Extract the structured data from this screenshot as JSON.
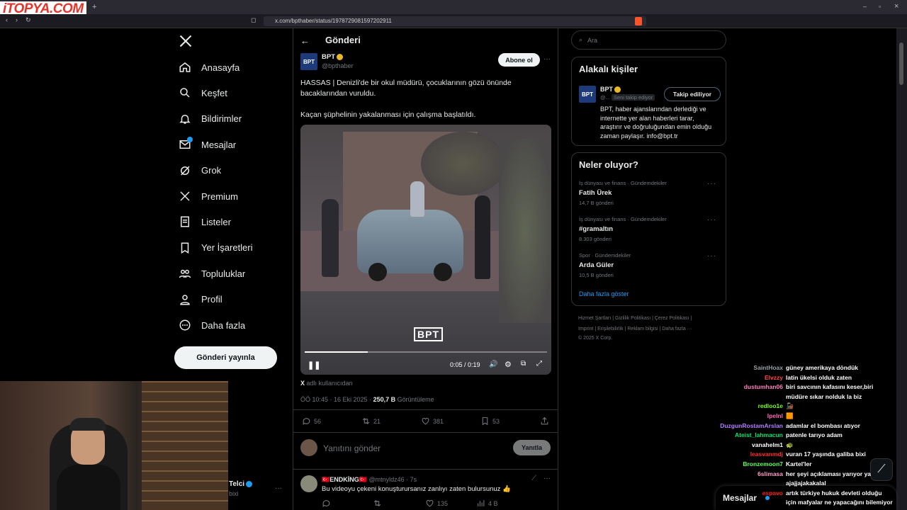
{
  "browser": {
    "watermark": "iTOPYA.COM",
    "new_tab": "+",
    "url": "x.com/bpthaber/status/1978729081597202911",
    "window_controls": [
      "–",
      "▫",
      "×"
    ]
  },
  "nav": {
    "items": [
      {
        "label": "Anasayfa",
        "icon": "home-icon"
      },
      {
        "label": "Keşfet",
        "icon": "search-icon"
      },
      {
        "label": "Bildirimler",
        "icon": "bell-icon"
      },
      {
        "label": "Mesajlar",
        "icon": "mail-icon"
      },
      {
        "label": "Grok",
        "icon": "grok-icon"
      },
      {
        "label": "Premium",
        "icon": "x-logo-icon"
      },
      {
        "label": "Listeler",
        "icon": "list-icon"
      },
      {
        "label": "Yer İşaretleri",
        "icon": "bookmark-icon"
      },
      {
        "label": "Topluluklar",
        "icon": "people-icon"
      },
      {
        "label": "Profil",
        "icon": "person-icon"
      },
      {
        "label": "Daha fazla",
        "icon": "more-circle-icon"
      }
    ],
    "post_button": "Gönderi yayınla",
    "account": {
      "name": "Telci",
      "handle": "bixi"
    }
  },
  "post": {
    "header_title": "Gönderi",
    "author_name": "BPT",
    "author_handle": "@bpthaber",
    "logo_text": "BPT",
    "subscribe_label": "Abone ol",
    "text_line1": "HASSAS | Denizli'de bir okul müdürü, çocuklarının gözü önünde",
    "text_line2": "bacaklarından vuruldu.",
    "text_line3": "Kaçan şüphelinin yakalanması için çalışma başlatıldı.",
    "video_time": "0:05 / 0:19",
    "video_progress": 0.26,
    "video_watermark": "BPT",
    "source_prefix": "X",
    "source_label": "adlı kullanıcıdan",
    "time": "ÖÖ 10:45 · 16 Eki 2025 ·",
    "views": "250,7 B",
    "views_label": "Görüntüleme",
    "replies": "56",
    "reposts": "21",
    "likes": "381",
    "bookmarks": "53",
    "reply_placeholder": "Yanıtını gönder",
    "reply_button": "Yanıtla"
  },
  "reply": {
    "name": "🇹🇷ENDKİNG🇹🇷",
    "handle": "@mtnyldz46",
    "time": "· 7s",
    "text": "Bu videoyu çekeni konuşturursanız zanlıyı zaten bulursunuz 👍",
    "likes": "135",
    "views": "4 B"
  },
  "right": {
    "search_placeholder": "Ara",
    "related_title": "Alakalı kişiler",
    "related_name": "BPT",
    "related_handle": "@...",
    "follows_you": "Seni takip ediyor",
    "following_button": "Takip ediliyor",
    "bio": [
      "BPT, haber ajanslarından derlediği ve",
      "internette yer alan haberleri tarar,",
      "araştırır ve doğruluğundan emin olduğu",
      "zaman paylaşır. info@bpt.tr"
    ],
    "trends_title": "Neler oluyor?",
    "trends": [
      {
        "category": "İş dünyası ve finans · Gündemdekiler",
        "name": "Fatih Ürek",
        "count": "14,7 B gönderi"
      },
      {
        "category": "İş dünyası ve finans · Gündemdekiler",
        "name": "#gramaltın",
        "count": "8.303 gönderi"
      },
      {
        "category": "Spor · Gündemdekiler",
        "name": "Arda Güler",
        "count": "10,5 B gönderi"
      }
    ],
    "show_more": "Daha fazla göster",
    "footer1": "Hizmet Şartları  |  Gizlilik Politikası  |  Çerez Politikası  |",
    "footer2": "Imprint  |  Erişilebilirlik  |  Reklam bilgisi  |  Daha fazla ···",
    "footer3": "© 2025 X Corp."
  },
  "messages_bar": {
    "label": "Mesajlar"
  },
  "chat": [
    {
      "user": "SaintHoax",
      "color": "#9aa0a6",
      "msg": "güney amerikaya döndük"
    },
    {
      "user": "Elvzzy",
      "color": "#ff4444",
      "msg": "latin ükelsi olduk zaten"
    },
    {
      "user": "dustumhan06",
      "color": "#ff7fbf",
      "msg": "biri savcının kafasını keser,biri"
    },
    {
      "user": "",
      "color": "#ffffff",
      "msg": "müdüre sıkar nolduk la biz"
    },
    {
      "user": "redloo1e",
      "color": "#7cfc00",
      "msg": "🚂"
    },
    {
      "user": "Ipelnl",
      "color": "#ff69b4",
      "msg": "🟧"
    },
    {
      "user": "DuzgunRostamArslan",
      "color": "#b57cff",
      "msg": "adamlar el bombası atıyor"
    },
    {
      "user": "Ateist_lahmacun",
      "color": "#00e676",
      "msg": "patenle tarıyo adam"
    },
    {
      "user": "vanahelm1",
      "color": "#ffffff",
      "msg": "🐢"
    },
    {
      "user": "leasvanmdj",
      "color": "#ff3030",
      "msg": "vuran 17 yaşında galiba bixi"
    },
    {
      "user": "Bronzemoon7",
      "color": "#5cff5c",
      "msg": "Kartel'ler"
    },
    {
      "user": "6slimasa",
      "color": "#ff9ec7",
      "msg": "her şeyi açıklaması yarıyor ya"
    },
    {
      "user": "",
      "color": "#ffffff",
      "msg": "ajajjajakakalal"
    },
    {
      "user": "espavo",
      "color": "#ff2020",
      "msg": "artık türkiye hukuk devleti olduğu"
    },
    {
      "user": "",
      "color": "#ffffff",
      "msg": "için mafyalar ne yapacağını bilemiyor"
    }
  ]
}
